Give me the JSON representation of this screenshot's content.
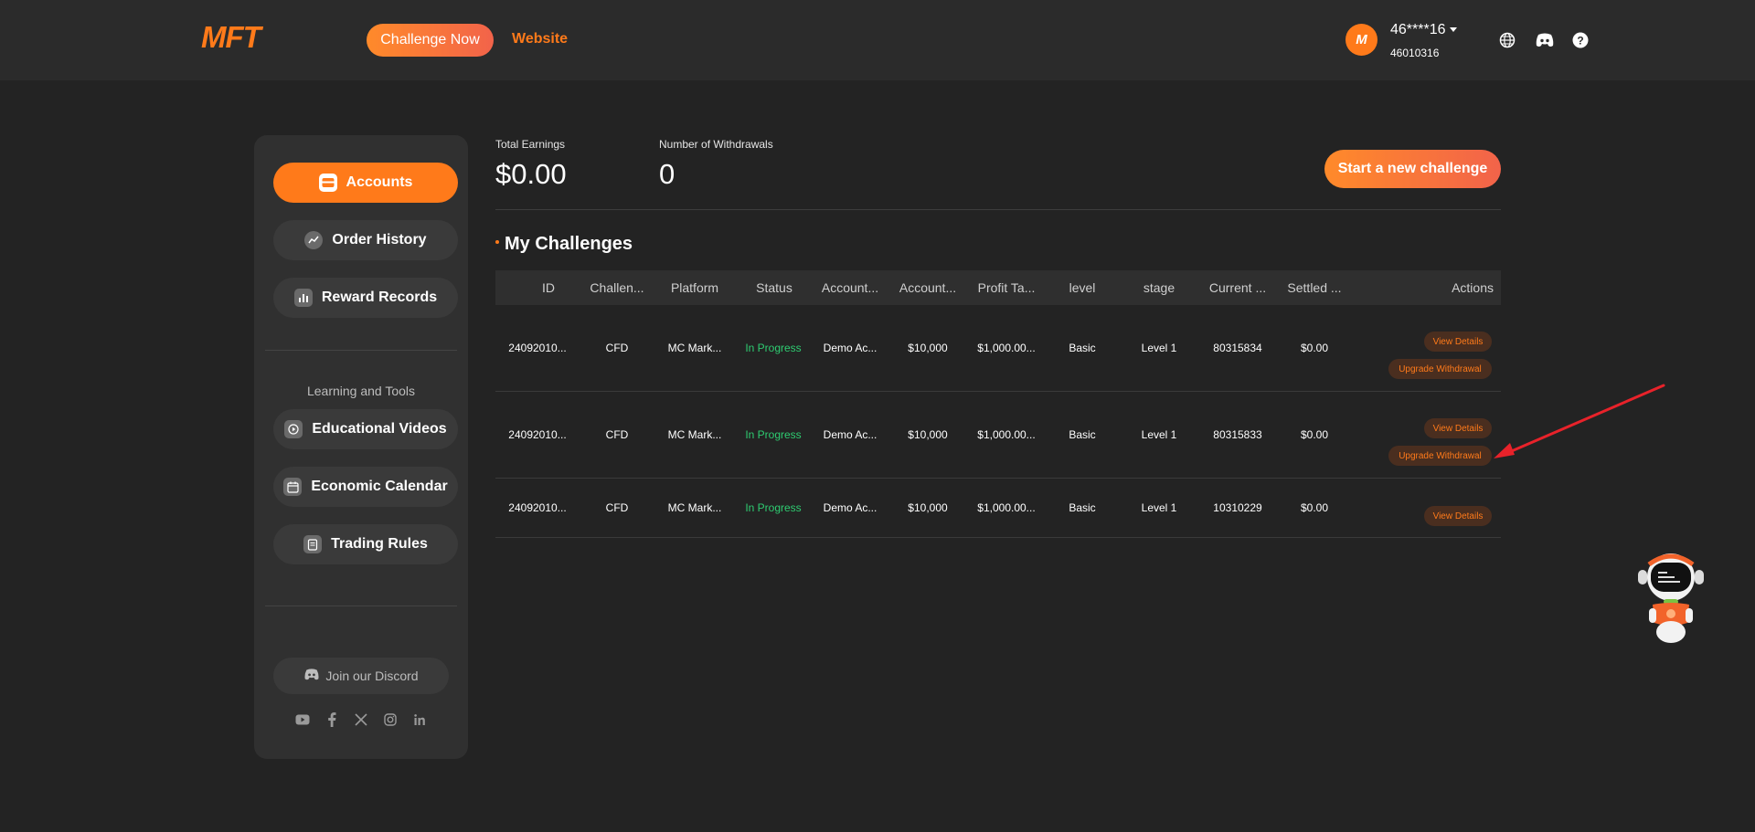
{
  "header": {
    "logo": "MFT",
    "challenge_now": "Challenge Now",
    "website": "Website",
    "avatar_letter": "M",
    "user_name": "46****16",
    "user_id": "46010316"
  },
  "sidebar": {
    "items": [
      {
        "label": "Accounts",
        "icon": "wallet-icon"
      },
      {
        "label": "Order History",
        "icon": "chart-icon"
      },
      {
        "label": "Reward Records",
        "icon": "bar-chart-icon"
      }
    ],
    "section_label": "Learning and Tools",
    "tools": [
      {
        "label": "Educational Videos",
        "icon": "play-icon"
      },
      {
        "label": "Economic Calendar",
        "icon": "calendar-icon"
      },
      {
        "label": "Trading Rules",
        "icon": "document-icon"
      }
    ],
    "discord": "Join our Discord",
    "socials": [
      "youtube-icon",
      "facebook-icon",
      "x-icon",
      "instagram-icon",
      "linkedin-icon"
    ]
  },
  "stats": {
    "earnings_label": "Total Earnings",
    "earnings_value": "$0.00",
    "withdrawals_label": "Number of Withdrawals",
    "withdrawals_value": "0",
    "new_challenge": "Start a new challenge"
  },
  "challenges": {
    "title": "My Challenges",
    "columns": [
      "ID",
      "Challen...",
      "Platform",
      "Status",
      "Account...",
      "Account...",
      "Profit Ta...",
      "level",
      "stage",
      "Current ...",
      "Settled ...",
      "Actions"
    ],
    "rows": [
      {
        "cells": [
          "24092010...",
          "CFD",
          "MC Mark...",
          "In Progress",
          "Demo Ac...",
          "$10,000",
          "$1,000.00...",
          "Basic",
          "Level 1",
          "80315834",
          "$0.00"
        ],
        "view": "View Details",
        "upgrade": "Upgrade Withdrawal"
      },
      {
        "cells": [
          "24092010...",
          "CFD",
          "MC Mark...",
          "In Progress",
          "Demo Ac...",
          "$10,000",
          "$1,000.00...",
          "Basic",
          "Level 1",
          "80315833",
          "$0.00"
        ],
        "view": "View Details",
        "upgrade": "Upgrade Withdrawal"
      },
      {
        "cells": [
          "24092010...",
          "CFD",
          "MC Mark...",
          "In Progress",
          "Demo Ac...",
          "$10,000",
          "$1,000.00...",
          "Basic",
          "Level 1",
          "10310229",
          "$0.00"
        ],
        "view": "View Details"
      }
    ]
  },
  "colors": {
    "accent": "#ff7a1a",
    "status_green": "#2ecc71",
    "background": "#232323"
  }
}
